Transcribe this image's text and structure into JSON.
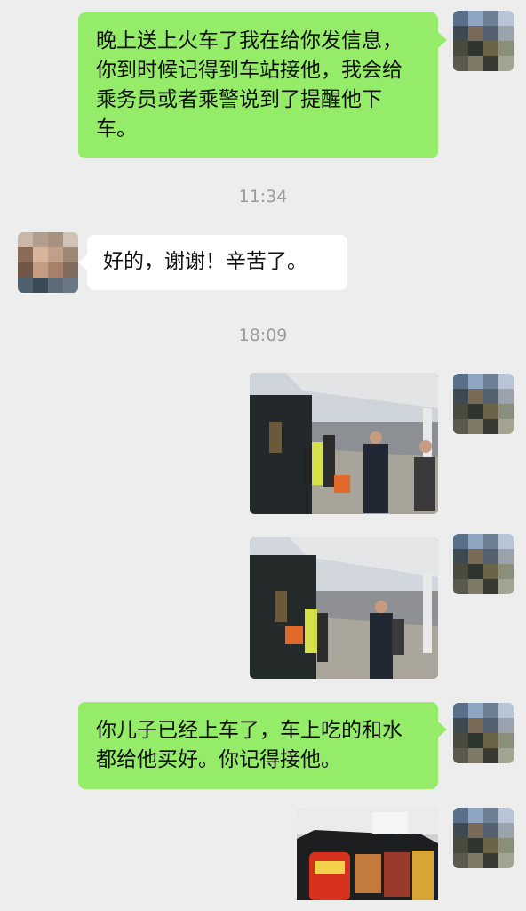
{
  "messages": {
    "m1": {
      "text": "晚上送上火车了我在给你发信息，你到时候记得到车站接他，我会给乘务员或者乘警说到了提醒他下车。",
      "sender": "me"
    },
    "t1": "11:34",
    "m2": {
      "text": "好的，谢谢！辛苦了。",
      "sender": "other"
    },
    "t2": "18:09",
    "m3": {
      "type": "image",
      "subject": "train-platform-photo",
      "sender": "me"
    },
    "m4": {
      "type": "image",
      "subject": "train-platform-photo",
      "sender": "me"
    },
    "m5": {
      "text": "你儿子已经上车了，车上吃的和水都给他买好。你记得接他。",
      "sender": "me"
    },
    "m6": {
      "type": "image",
      "subject": "food-bag-photo",
      "sender": "me"
    }
  },
  "colors": {
    "chat_bg": "#ededed",
    "sent_bubble": "#95ec69",
    "received_bubble": "#ffffff",
    "timestamp": "#9a9a9a"
  }
}
